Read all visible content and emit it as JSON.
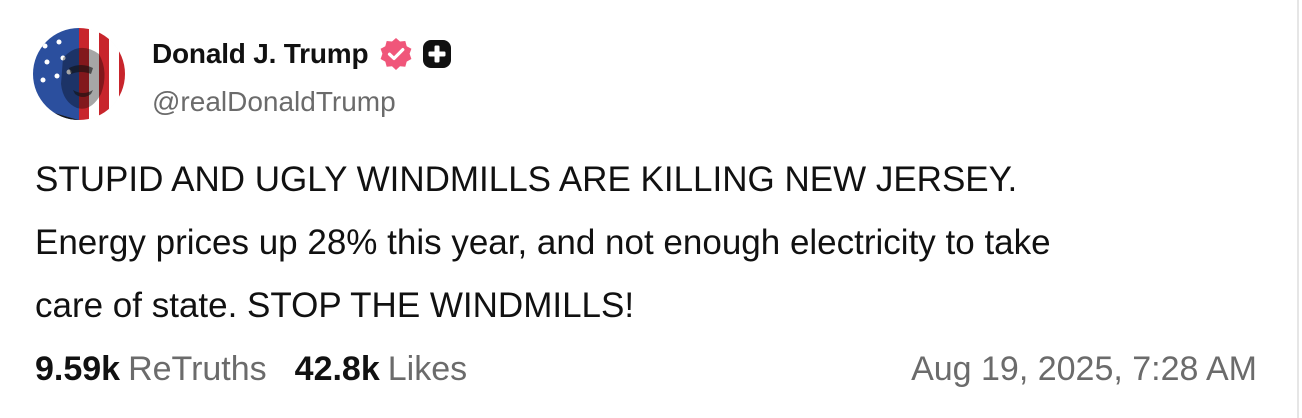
{
  "post": {
    "author_name": "Donald J. Trump",
    "handle": "@realDonaldTrump",
    "verified_icon": "verified-badge-icon",
    "plus_icon": "plus-badge-icon",
    "text_lines": [
      "STUPID AND UGLY WINDMILLS ARE KILLING NEW JERSEY.",
      "Energy prices up 28% this year, and not enough electricity to take",
      "care of state. STOP THE WINDMILLS!"
    ],
    "retruths_count": "9.59k",
    "retruths_label": "ReTruths",
    "likes_count": "42.8k",
    "likes_label": "Likes",
    "timestamp": "Aug 19, 2025, 7:28 AM"
  },
  "colors": {
    "verified_badge": "#f0567a",
    "plus_badge": "#111111",
    "text_primary": "#111111",
    "text_secondary": "#6b6b6b"
  }
}
